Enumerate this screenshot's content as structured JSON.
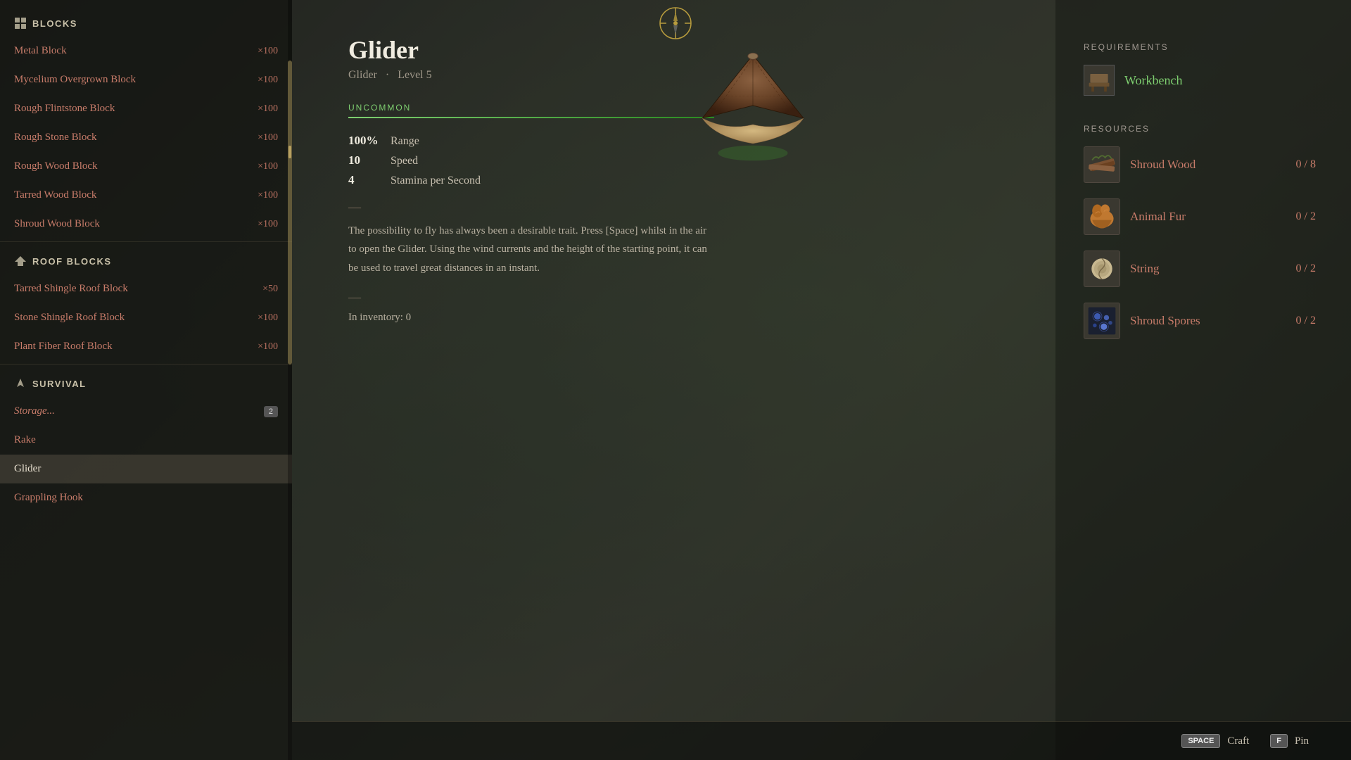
{
  "sidebar": {
    "sections": [
      {
        "id": "blocks",
        "label": "BLOCKS",
        "icon": "blocks-icon",
        "items": [
          {
            "name": "Metal Block",
            "count": "×100",
            "active": false
          },
          {
            "name": "Mycelium Overgrown Block",
            "count": "×100",
            "active": false
          },
          {
            "name": "Rough Flintstone Block",
            "count": "×100",
            "active": false
          },
          {
            "name": "Rough Stone Block",
            "count": "×100",
            "active": false
          },
          {
            "name": "Rough Wood Block",
            "count": "×100",
            "active": false
          },
          {
            "name": "Tarred Wood Block",
            "count": "×100",
            "active": false
          },
          {
            "name": "Shroud Wood Block",
            "count": "×100",
            "active": false
          }
        ]
      },
      {
        "id": "roof-blocks",
        "label": "ROOF BLOCKS",
        "icon": "roof-icon",
        "items": [
          {
            "name": "Tarred Shingle Roof Block",
            "count": "×50",
            "active": false
          },
          {
            "name": "Stone Shingle Roof Block",
            "count": "×100",
            "active": false
          },
          {
            "name": "Plant Fiber Roof Block",
            "count": "×100",
            "active": false
          }
        ]
      },
      {
        "id": "survival",
        "label": "SURVIVAL",
        "icon": "survival-icon",
        "items": [
          {
            "name": "Storage...",
            "count": "",
            "badge": "2",
            "active": false
          },
          {
            "name": "Rake",
            "count": "",
            "active": false
          },
          {
            "name": "Glider",
            "count": "",
            "active": true
          },
          {
            "name": "Grappling Hook",
            "count": "",
            "active": false
          }
        ]
      }
    ]
  },
  "detail": {
    "title": "Glider",
    "subtitle_category": "Glider",
    "subtitle_level": "Level 5",
    "rarity": "UNCOMMON",
    "stats": [
      {
        "value": "100%",
        "label": "Range"
      },
      {
        "value": "10",
        "label": "Speed"
      },
      {
        "value": "4",
        "label": "Stamina per Second"
      }
    ],
    "description": "The possibility to fly has always been a desirable trait. Press [Space] whilst in the air to open the Glider. Using the wind currents and the height of the starting point, it can be used to travel great distances in an instant.",
    "inventory_label": "In inventory:",
    "inventory_count": "0"
  },
  "requirements": {
    "section_title": "REQUIREMENTS",
    "workbench_label": "Workbench"
  },
  "resources": {
    "section_title": "RESOURCES",
    "items": [
      {
        "name": "Shroud Wood",
        "have": "0",
        "need": "8"
      },
      {
        "name": "Animal Fur",
        "have": "0",
        "need": "2"
      },
      {
        "name": "String",
        "have": "0",
        "need": "2"
      },
      {
        "name": "Shroud Spores",
        "have": "0",
        "need": "2"
      }
    ]
  },
  "keybinds": [
    {
      "key": "SPACE",
      "action": "Craft"
    },
    {
      "key": "F",
      "action": "Pin"
    }
  ]
}
